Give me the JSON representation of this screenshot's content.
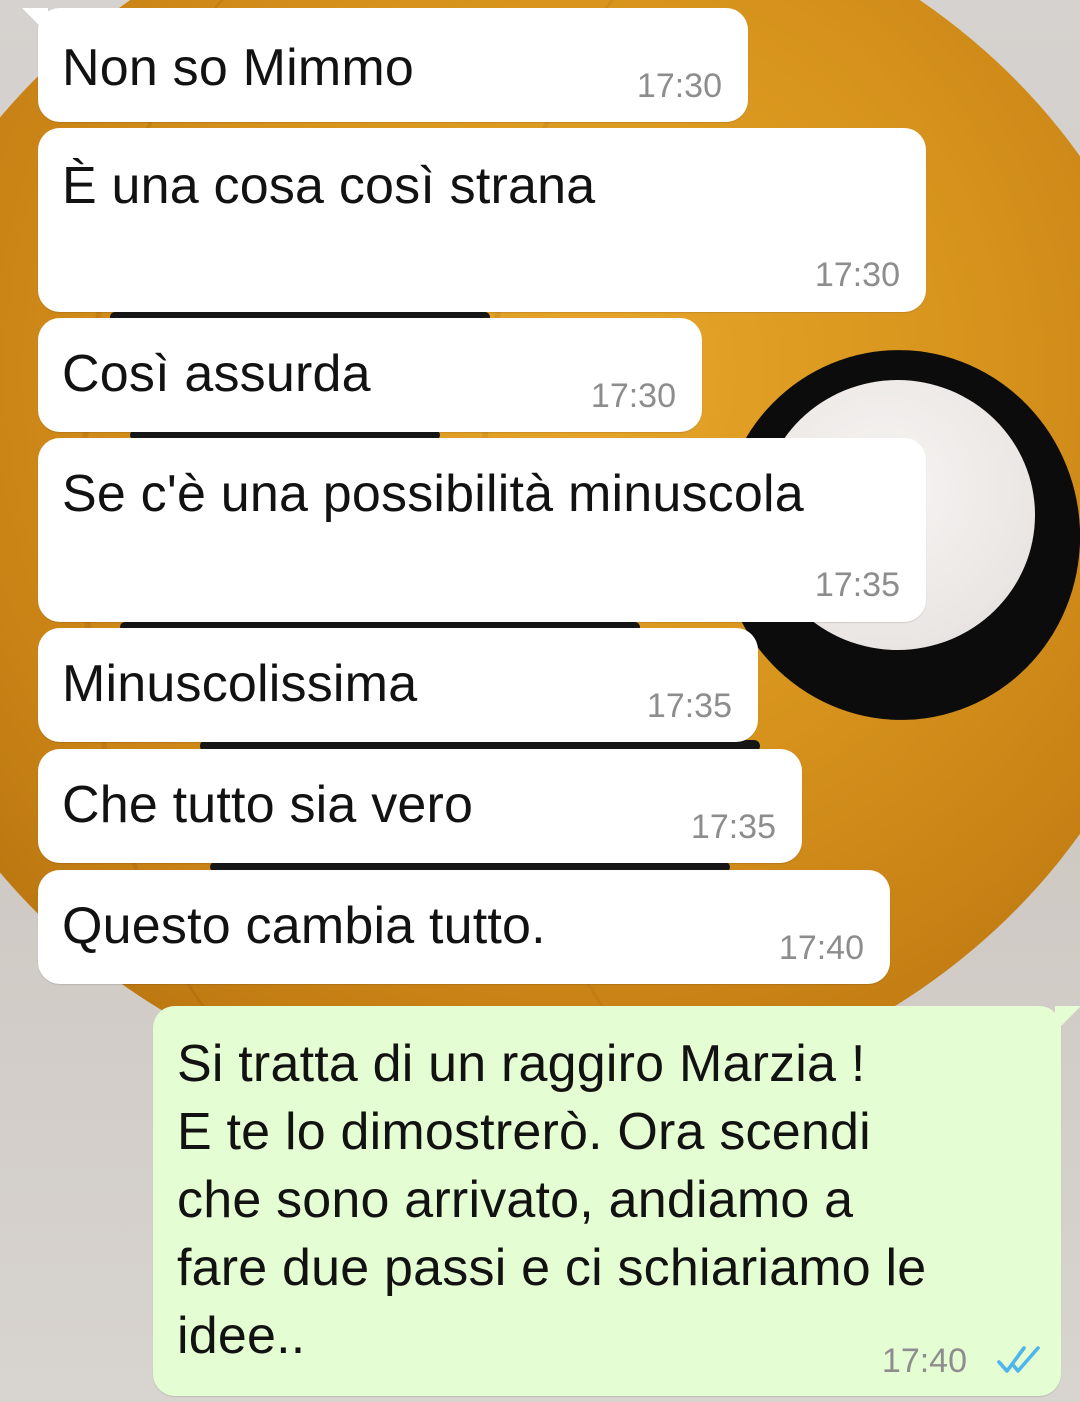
{
  "conversation": {
    "messages": [
      {
        "direction": "incoming",
        "text": "Non so Mimmo",
        "time": "17:30"
      },
      {
        "direction": "incoming",
        "text": "È una cosa così strana",
        "time": "17:30"
      },
      {
        "direction": "incoming",
        "text": "Così assurda",
        "time": "17:30"
      },
      {
        "direction": "incoming",
        "text": "Se c'è una possibilità minuscola",
        "time": "17:35"
      },
      {
        "direction": "incoming",
        "text": "Minuscolissima",
        "time": "17:35"
      },
      {
        "direction": "incoming",
        "text": "Che tutto sia vero",
        "time": "17:35"
      },
      {
        "direction": "incoming",
        "text": "Questo cambia tutto.",
        "time": "17:40"
      },
      {
        "direction": "outgoing",
        "text": "Si tratta di un raggiro Marzia !\nE te lo dimostrerò. Ora scendi\nche sono arrivato, andiamo a\nfare due passi e ci schiariamo le\nidee..",
        "time": "17:40",
        "status_icon": "double-check-read-icon"
      }
    ]
  },
  "colors": {
    "incoming_bubble": "#ffffff",
    "outgoing_bubble": "#e4fdd3",
    "timestamp": "#8d8d8d",
    "read_ticks": "#4fb6ec"
  }
}
